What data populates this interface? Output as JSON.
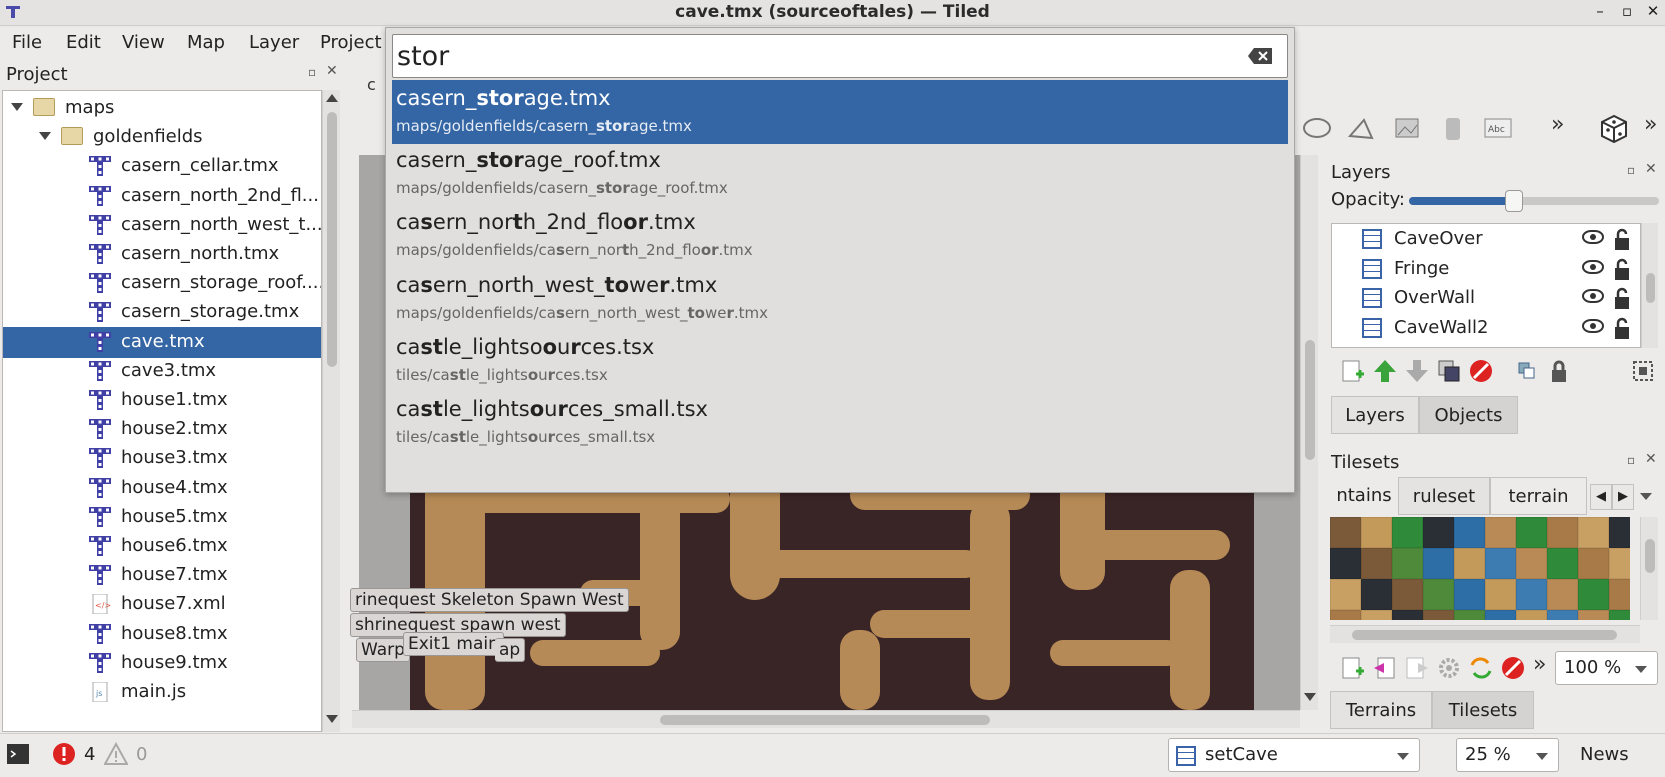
{
  "window": {
    "title": "cave.tmx (sourceoftales) — Tiled"
  },
  "menu": [
    "File",
    "Edit",
    "View",
    "Map",
    "Layer",
    "Project"
  ],
  "project_panel": {
    "title": "Project",
    "items": [
      {
        "label": "maps",
        "type": "folder",
        "depth": 0
      },
      {
        "label": "goldenfields",
        "type": "folder",
        "depth": 1
      },
      {
        "label": "casern_cellar.tmx",
        "type": "tmx",
        "depth": 2
      },
      {
        "label": "casern_north_2nd_fl...",
        "type": "tmx",
        "depth": 2
      },
      {
        "label": "casern_north_west_t...",
        "type": "tmx",
        "depth": 2
      },
      {
        "label": "casern_north.tmx",
        "type": "tmx",
        "depth": 2
      },
      {
        "label": "casern_storage_roof....",
        "type": "tmx",
        "depth": 2
      },
      {
        "label": "casern_storage.tmx",
        "type": "tmx",
        "depth": 2
      },
      {
        "label": "cave.tmx",
        "type": "tmx",
        "depth": 2,
        "selected": true
      },
      {
        "label": "cave3.tmx",
        "type": "tmx",
        "depth": 2
      },
      {
        "label": "house1.tmx",
        "type": "tmx",
        "depth": 2
      },
      {
        "label": "house2.tmx",
        "type": "tmx",
        "depth": 2
      },
      {
        "label": "house3.tmx",
        "type": "tmx",
        "depth": 2
      },
      {
        "label": "house4.tmx",
        "type": "tmx",
        "depth": 2
      },
      {
        "label": "house5.tmx",
        "type": "tmx",
        "depth": 2
      },
      {
        "label": "house6.tmx",
        "type": "tmx",
        "depth": 2
      },
      {
        "label": "house7.tmx",
        "type": "tmx",
        "depth": 2
      },
      {
        "label": "house7.xml",
        "type": "xml",
        "depth": 2
      },
      {
        "label": "house8.tmx",
        "type": "tmx",
        "depth": 2
      },
      {
        "label": "house9.tmx",
        "type": "tmx",
        "depth": 2
      },
      {
        "label": "main.js",
        "type": "js",
        "depth": 2
      }
    ]
  },
  "search": {
    "query": "stor",
    "results": [
      {
        "name_html": "casern_<b class='hl'>stor</b>age.tmx",
        "path_html": "maps/goldenfields/casern_<b class='hl'>stor</b>age.tmx",
        "name": "casern_storage.tmx",
        "path": "maps/goldenfields/casern_storage.tmx",
        "selected": true
      },
      {
        "name_html": "casern_<b class='hl'>stor</b>age_roof.tmx",
        "path_html": "maps/goldenfields/casern_<b class='hl'>stor</b>age_roof.tmx",
        "name": "casern_storage_roof.tmx",
        "path": "maps/goldenfields/casern_storage_roof.tmx"
      },
      {
        "name_html": "ca<b class='hl'>s</b>ern_nor<b class='hl'>t</b>h_2nd_flo<b class='hl'>or</b>.tmx",
        "path_html": "maps/goldenfields/ca<b class='hl'>s</b>ern_nor<b class='hl'>t</b>h_2nd_flo<b class='hl'>or</b>.tmx",
        "name": "casern_north_2nd_floor.tmx",
        "path": "maps/goldenfields/casern_north_2nd_floor.tmx"
      },
      {
        "name_html": "ca<b class='hl'>s</b>ern_north_west_<b class='hl'>to</b>we<b class='hl'>r</b>.tmx",
        "path_html": "maps/goldenfields/ca<b class='hl'>s</b>ern_north_west_<b class='hl'>to</b>we<b class='hl'>r</b>.tmx",
        "name": "casern_north_west_tower.tmx",
        "path": "maps/goldenfields/casern_north_west_tower.tmx"
      },
      {
        "name_html": "ca<b class='hl'>st</b>le_lightso<b class='hl'>o</b>u<b class='hl'>r</b>ces.tsx",
        "path_html": "tiles/ca<b class='hl'>st</b>le_lights<b class='hl'>o</b>u<b class='hl'>r</b>ces.tsx",
        "name": "castle_lightsources.tsx",
        "path": "tiles/castle_lightsources.tsx"
      },
      {
        "name_html": "ca<b class='hl'>st</b>le_lights<b class='hl'>o</b>u<b class='hl'>r</b>ces_small.tsx",
        "path_html": "tiles/ca<b class='hl'>st</b>le_lights<b class='hl'>o</b>u<b class='hl'>r</b>ces_small.tsx",
        "name": "castle_lightsources_small.tsx",
        "path": "tiles/castle_lightsources_small.tsx"
      }
    ]
  },
  "map_objects": [
    "rinequest Skeleton Spawn West",
    "shrinequest spawn west",
    "Warp",
    "Exit1 main",
    "ap"
  ],
  "layers_panel": {
    "title": "Layers",
    "opacity_label": "Opacity:",
    "opacity": 0.42,
    "layers": [
      "CaveOver",
      "Fringe",
      "OverWall",
      "CaveWall2"
    ],
    "tabs": [
      "Layers",
      "Objects"
    ]
  },
  "tilesets_panel": {
    "title": "Tilesets",
    "tabs": [
      "ntains",
      "ruleset",
      "terrain"
    ],
    "zoom": "100 %",
    "bottom_tabs": [
      "Terrains",
      "Tilesets"
    ]
  },
  "status": {
    "errors": "4",
    "warnings": "0",
    "layer": "setCave",
    "zoom": "25 %",
    "news": "News"
  },
  "colors": {
    "selection": "#3465a4",
    "cave_bg": "#3a2526",
    "cave_path": "#b68a56"
  }
}
